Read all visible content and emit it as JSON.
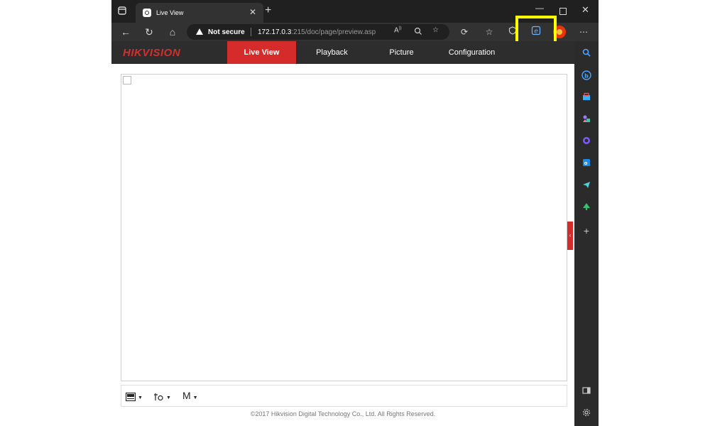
{
  "browser": {
    "tab_title": "Live View",
    "tab_close": "✕",
    "new_tab": "+",
    "window_controls": {
      "minimize": "—",
      "close": "✕"
    },
    "address": {
      "security_label": "Not secure",
      "url_host": "172.17.0.3",
      "url_rest": ":215/doc/page/preview.asp"
    },
    "icons": [
      "back-icon",
      "reload-icon",
      "home-icon",
      "read-aloud-icon",
      "zoom-icon",
      "add-favorite-icon",
      "extensions-icon",
      "favorites-icon",
      "browser-essentials-icon",
      "internet-explorer-mode-icon",
      "profile-icon",
      "more-icon"
    ],
    "highlight_color": "#ffff00"
  },
  "sidebar": {
    "icons": [
      "search-icon",
      "bing-icon",
      "shopping-icon",
      "games-icon",
      "copilot-icon",
      "outlook-icon",
      "telegram-icon",
      "tree-icon",
      "add-icon",
      "sidebar-toggle-icon",
      "settings-icon"
    ],
    "add_label": "+"
  },
  "app": {
    "logo": "HIKVISION",
    "brand_color": "#d52b2b",
    "nav": {
      "live_view": "Live View",
      "playback": "Playback",
      "picture": "Picture",
      "configuration": "Configuration"
    },
    "controls": {
      "mode_label": "M"
    },
    "footer": "©2017 Hikvision Digital Technology Co., Ltd. All Rights Reserved."
  }
}
